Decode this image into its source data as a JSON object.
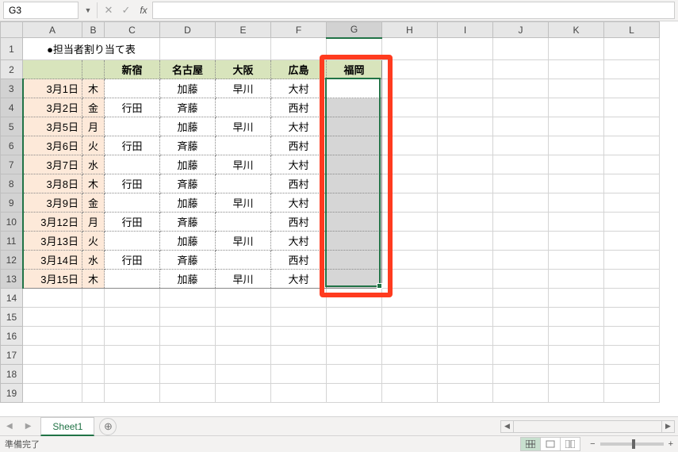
{
  "nameBox": "G3",
  "fx": "fx",
  "title": "●担当者割り当て表",
  "columns": [
    "A",
    "B",
    "C",
    "D",
    "E",
    "F",
    "G",
    "H",
    "I",
    "J",
    "K",
    "L"
  ],
  "headers": {
    "c": "新宿",
    "d": "名古屋",
    "e": "大阪",
    "f": "広島",
    "g": "福岡"
  },
  "rows": [
    {
      "n": 1
    },
    {
      "n": 2
    },
    {
      "n": 3,
      "date": "3月1日",
      "day": "木",
      "c": "",
      "d": "加藤",
      "e": "早川",
      "f": "大村"
    },
    {
      "n": 4,
      "date": "3月2日",
      "day": "金",
      "c": "行田",
      "d": "斉藤",
      "e": "",
      "f": "西村"
    },
    {
      "n": 5,
      "date": "3月5日",
      "day": "月",
      "c": "",
      "d": "加藤",
      "e": "早川",
      "f": "大村"
    },
    {
      "n": 6,
      "date": "3月6日",
      "day": "火",
      "c": "行田",
      "d": "斉藤",
      "e": "",
      "f": "西村"
    },
    {
      "n": 7,
      "date": "3月7日",
      "day": "水",
      "c": "",
      "d": "加藤",
      "e": "早川",
      "f": "大村"
    },
    {
      "n": 8,
      "date": "3月8日",
      "day": "木",
      "c": "行田",
      "d": "斉藤",
      "e": "",
      "f": "西村"
    },
    {
      "n": 9,
      "date": "3月9日",
      "day": "金",
      "c": "",
      "d": "加藤",
      "e": "早川",
      "f": "大村"
    },
    {
      "n": 10,
      "date": "3月12日",
      "day": "月",
      "c": "行田",
      "d": "斉藤",
      "e": "",
      "f": "西村"
    },
    {
      "n": 11,
      "date": "3月13日",
      "day": "火",
      "c": "",
      "d": "加藤",
      "e": "早川",
      "f": "大村"
    },
    {
      "n": 12,
      "date": "3月14日",
      "day": "水",
      "c": "行田",
      "d": "斉藤",
      "e": "",
      "f": "西村"
    },
    {
      "n": 13,
      "date": "3月15日",
      "day": "木",
      "c": "",
      "d": "加藤",
      "e": "早川",
      "f": "大村"
    },
    {
      "n": 14
    },
    {
      "n": 15
    },
    {
      "n": 16
    },
    {
      "n": 17
    },
    {
      "n": 18
    },
    {
      "n": 19
    }
  ],
  "sheetTab": "Sheet1",
  "status": "準備完了",
  "selection": {
    "col": "G",
    "rowStart": 3,
    "rowEnd": 13,
    "activeRow": 3
  }
}
